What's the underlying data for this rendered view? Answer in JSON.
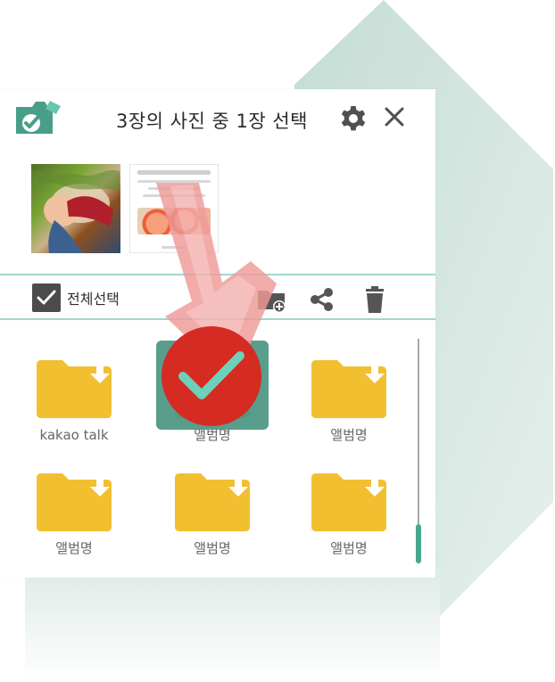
{
  "header": {
    "title": "3장의 사진 중 1장 선택"
  },
  "icons": {
    "app": "camera-check-icon",
    "settings": "gear-icon",
    "close": "close-icon",
    "new_folder": "new-folder-icon",
    "share": "share-icon",
    "delete": "trash-icon"
  },
  "toolbar": {
    "select_all_label": "전체선택"
  },
  "albums": [
    {
      "label": "kakao talk"
    },
    {
      "label": "앨범명"
    },
    {
      "label": "앨범명"
    },
    {
      "label": "앨범명"
    },
    {
      "label": "앨범명"
    },
    {
      "label": "앨범명"
    }
  ],
  "colors": {
    "accent": "#47a78f",
    "folder": "#f2bf31",
    "highlight_red": "#d52b22",
    "divider": "#9fd8d0"
  }
}
